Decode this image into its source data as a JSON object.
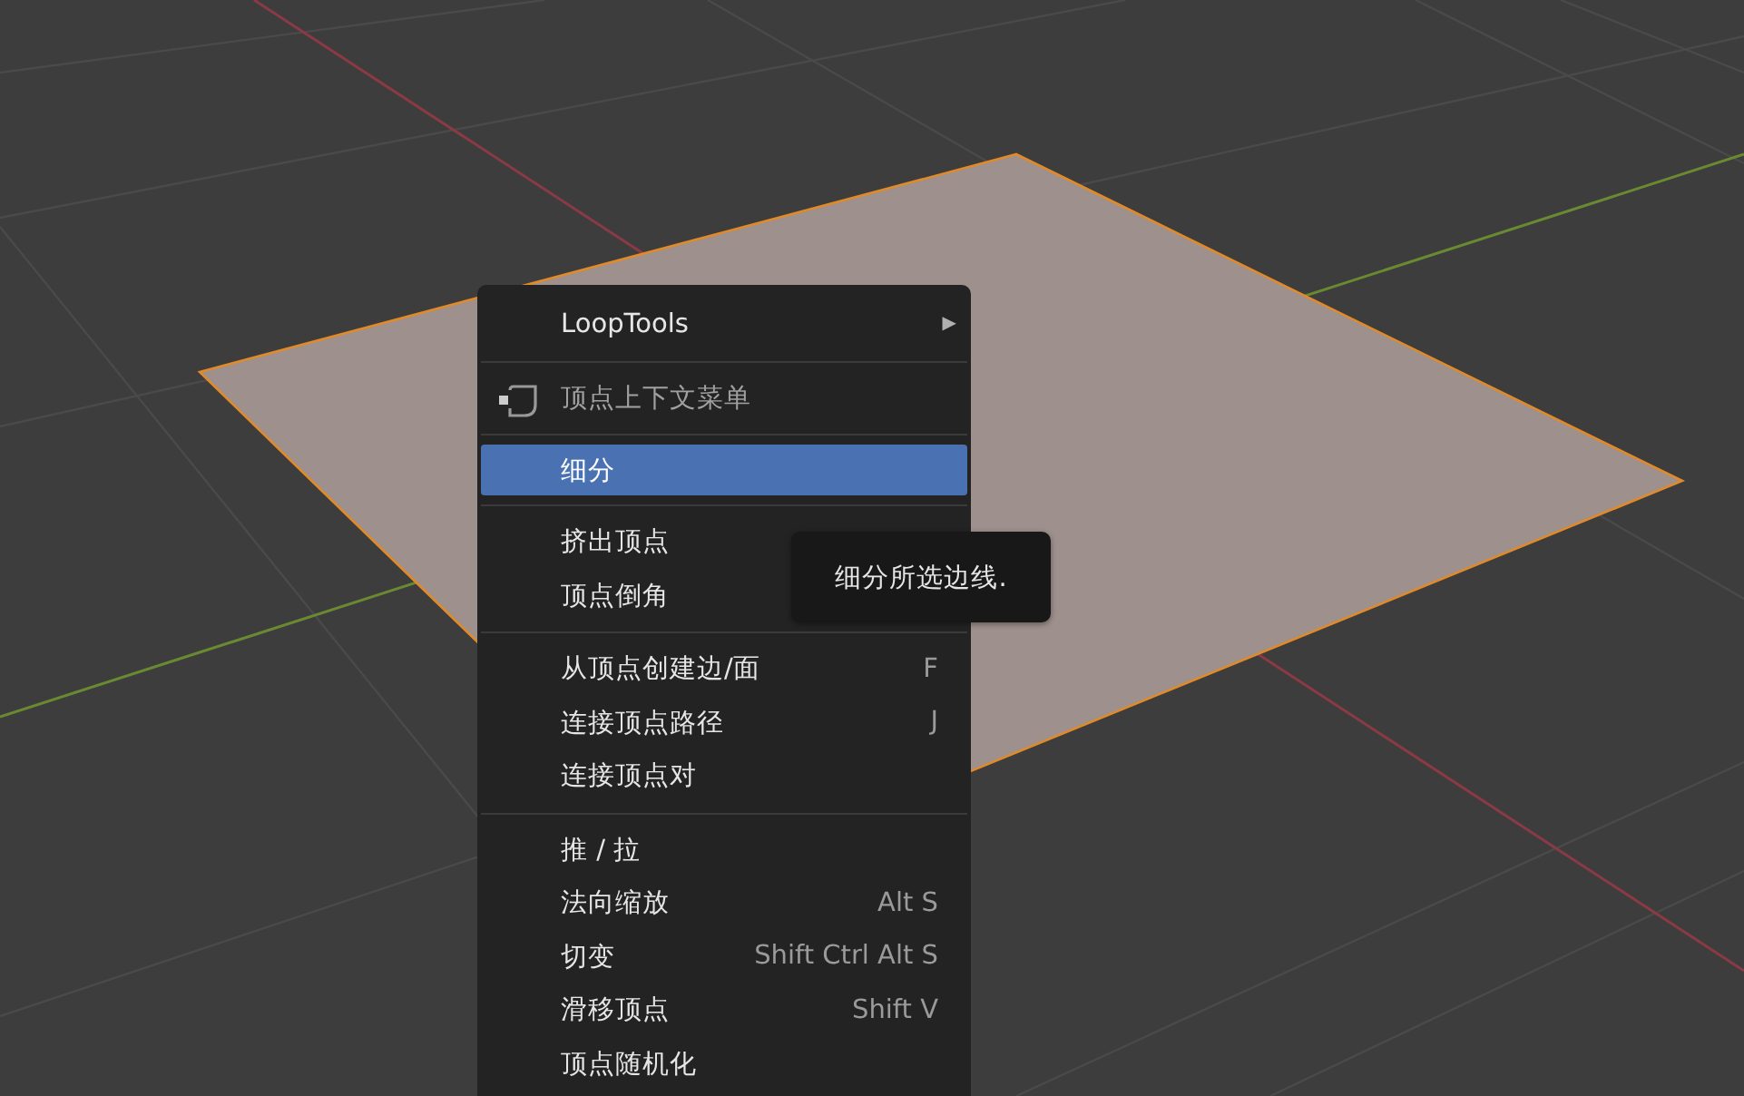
{
  "context_menu": {
    "sections": [
      {
        "items": [
          {
            "kind": "submenu",
            "label": "LoopTools",
            "arrow": "▶",
            "selected": false
          }
        ]
      },
      {
        "items": [
          {
            "kind": "header",
            "label": "顶点上下文菜单",
            "selected": false
          }
        ]
      },
      {
        "items": [
          {
            "kind": "item",
            "label": "细分",
            "selected": true
          }
        ]
      },
      {
        "items": [
          {
            "kind": "item",
            "label": "挤出顶点",
            "selected": false
          },
          {
            "kind": "item",
            "label": "顶点倒角",
            "selected": false
          }
        ]
      },
      {
        "items": [
          {
            "kind": "item",
            "label": "从顶点创建边/面",
            "shortcut": "F",
            "selected": false
          },
          {
            "kind": "item",
            "label": "连接顶点路径",
            "shortcut": "J",
            "selected": false
          },
          {
            "kind": "item",
            "label": "连接顶点对",
            "selected": false
          }
        ]
      },
      {
        "items": [
          {
            "kind": "item",
            "label": "推 / 拉",
            "selected": false
          },
          {
            "kind": "item",
            "label": "法向缩放",
            "shortcut": "Alt S",
            "selected": false
          },
          {
            "kind": "item",
            "label": "切变",
            "shortcut": "Shift Ctrl Alt S",
            "selected": false
          },
          {
            "kind": "item",
            "label": "滑移顶点",
            "shortcut": "Shift V",
            "selected": false
          },
          {
            "kind": "item",
            "label": "顶点随机化",
            "selected": false
          }
        ]
      }
    ]
  },
  "tooltip": {
    "text": "细分所选边线."
  }
}
